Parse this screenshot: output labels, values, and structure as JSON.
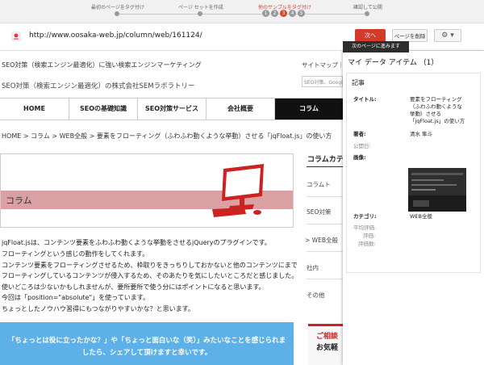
{
  "progress": {
    "steps": [
      {
        "label": "最初のページをタグ付け",
        "active": false
      },
      {
        "label": "ページ セットを作成",
        "active": false
      },
      {
        "label": "他のサンプルをタグ付け",
        "active": true
      },
      {
        "label": "確認して公開",
        "active": false
      }
    ],
    "numbers": [
      "1",
      "2",
      "3",
      "4",
      "5"
    ],
    "active_number": "3"
  },
  "toolbar": {
    "url": "http://www.oosaka-web.jp/column/web/161124/",
    "next_label": "次へ",
    "delete_label": "ページを削除",
    "settings_icon": "⚙ ▾"
  },
  "site": {
    "tagline": "SEO対策（検索エンジン最適化）に強い検索エンジンマーケティング",
    "company": "SEO対策（検索エンジン最適化）の株式会社SEMラボラトリー",
    "top_links": "サイトマップ｜",
    "search_placeholder": "SEO対策、Googl",
    "nav": [
      "HOME",
      "SEOの基礎知識",
      "SEO対策サービス",
      "会社概要",
      "コラム"
    ],
    "nav_active_index": 4,
    "breadcrumb": "HOME > コラム > WEB全般 > 要素をフローティング（ふわふわ動くような挙動）させる「jqFloat.js」の使い方",
    "banner_label": "コラム",
    "body_lines": [
      "jqFloat.jsは、コンテンツ要素をふわふわ動くような挙動をさせるjQueryのプラグインです。",
      "フローティングという感じの動作をしてくれます。",
      "コンテンツ要素をフローティングさせるため、枠取りをきっちりしておかないと他のコンテンツにまで",
      "フローティングしているコンテンツが侵入するため、そのあたりを気にしたいところだと感じました。",
      "使いどころは少ないかもしれませんが、要所要所で使う分にはポイントになると思います。",
      "今回は「position=\"absolute\"」を使っています。",
      "ちょっとしたノウハウ習得にもつながりやすいかな？と思います。"
    ],
    "cta_lines": [
      "「ちょっとは役に立ったかな？」や「ちょっと面白いな（笑）」みたいなことを感じられま",
      "したら、シェアして頂けますと幸いです。"
    ],
    "sidebar": {
      "heading": "コラムカテ",
      "items": [
        "コラムト",
        "SEO対策",
        "WEB全般",
        "社内",
        "その他"
      ],
      "contact_line1": "ご相談",
      "contact_line2": "お気軽"
    }
  },
  "panel": {
    "tooltip": "次のページに進みます",
    "title": "マイ データ アイテム （1）",
    "card_heading": "記事",
    "fields": {
      "title_label": "タイトル:",
      "title_value": [
        "要素をフローティング",
        "（ふわふわ動くような",
        "挙動）させる",
        "「jqFloat.js」の使い方"
      ],
      "author_label": "著者:",
      "author_value": "清水 隼斗",
      "published_label": "公開日:",
      "image_label": "画像:",
      "category_label": "カテゴリ:",
      "category_value": "WEB全般",
      "avg_rating_label": "平均評価:",
      "rating_label": "評価:",
      "rating_count_label": "評価数:"
    }
  },
  "colors": {
    "accent": "#d33a2c",
    "cta": "#5eb0e8",
    "banner_stripe": "#d9a1a1",
    "computer_icon": "#cc2222"
  }
}
